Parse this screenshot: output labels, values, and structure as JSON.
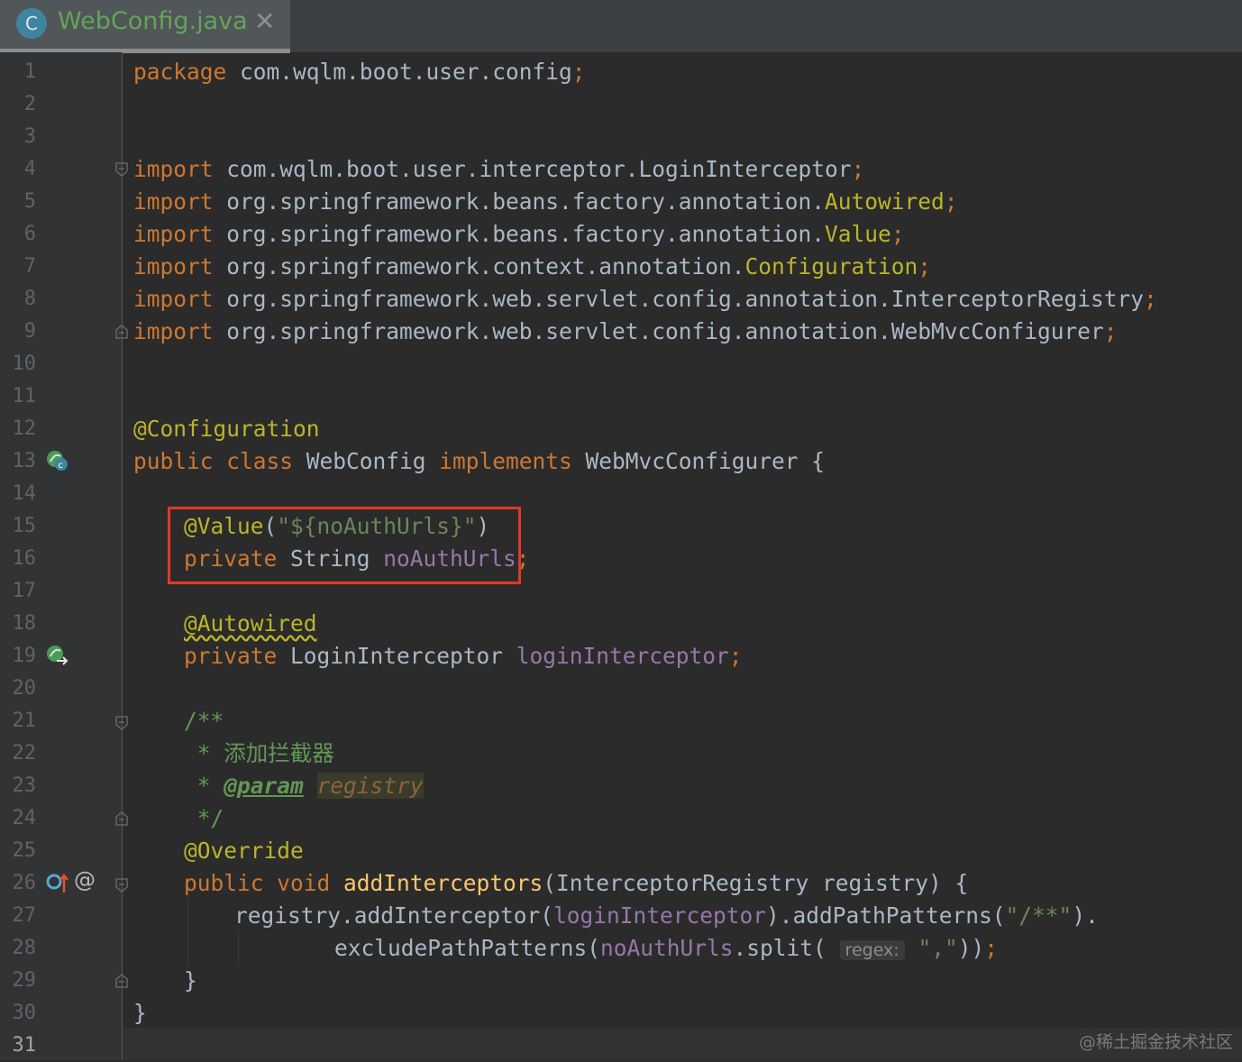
{
  "tab": {
    "icon_letter": "C",
    "title": "WebConfig.java",
    "close": "✕"
  },
  "line_numbers": [
    "1",
    "2",
    "3",
    "4",
    "5",
    "6",
    "7",
    "8",
    "9",
    "10",
    "11",
    "12",
    "13",
    "14",
    "15",
    "16",
    "17",
    "18",
    "19",
    "20",
    "21",
    "22",
    "23",
    "24",
    "25",
    "26",
    "27",
    "28",
    "29",
    "30",
    "31"
  ],
  "code": {
    "l1": {
      "kw": "package",
      "rest": " com.wqlm.boot.user.config",
      "semi": ";"
    },
    "l4": {
      "kw": "import",
      "rest": " com.wqlm.boot.user.interceptor.LoginInterceptor",
      "semi": ";"
    },
    "l5": {
      "kw": "import",
      "rest": " org.springframework.beans.factory.annotation.",
      "ann": "Autowired",
      "semi": ";"
    },
    "l6": {
      "kw": "import",
      "rest": " org.springframework.beans.factory.annotation.",
      "ann": "Value",
      "semi": ";"
    },
    "l7": {
      "kw": "import",
      "rest": " org.springframework.context.annotation.",
      "ann": "Configuration",
      "semi": ";"
    },
    "l8": {
      "kw": "import",
      "rest": " org.springframework.web.servlet.config.annotation.InterceptorRegistry",
      "semi": ";"
    },
    "l9": {
      "kw": "import",
      "rest": " org.springframework.web.servlet.config.annotation.WebMvcConfigurer",
      "semi": ";"
    },
    "l12": {
      "ann": "@Configuration"
    },
    "l13": {
      "kw1": "public class",
      "name": " WebConfig ",
      "kw2": "implements",
      "rest": " WebMvcConfigurer {"
    },
    "l15": {
      "ann": "@Value",
      "open": "(",
      "str": "\"${noAuthUrls}\"",
      "close": ")"
    },
    "l16": {
      "kw": "private",
      "type": " String ",
      "field": "noAuthUrls",
      "semi": ";"
    },
    "l18": {
      "ann": "@Autowired"
    },
    "l19": {
      "kw": "private",
      "type": " LoginInterceptor ",
      "field": "loginInterceptor",
      "semi": ";"
    },
    "l21": {
      "doc": "/**"
    },
    "l22": {
      "doc": " * 添加拦截器"
    },
    "l23": {
      "doc": " * ",
      "tag": "@param",
      "param": "registry"
    },
    "l24": {
      "doc": " */"
    },
    "l25": {
      "ann": "@Override"
    },
    "l26": {
      "kw": "public void",
      "fn": " addInterceptors",
      "rest": "(InterceptorRegistry registry) {"
    },
    "l27": {
      "a": "registry.addInterceptor(",
      "field": "loginInterceptor",
      "b": ").addPathPatterns(",
      "str": "\"/**\"",
      "c": ")."
    },
    "l28": {
      "a": "excludePathPatterns(",
      "field": "noAuthUrls",
      "b": ".split( ",
      "hint": "regex:",
      "str": "\",\"",
      "c": "))",
      "semi": ";"
    },
    "l29": {
      "text": "}"
    },
    "l30": {
      "text": "}"
    }
  },
  "gutter_icons": {
    "l13": "bean-class-icon",
    "l19": "autowired-navigate-icon",
    "l26": "override-method-icon",
    "l26_at": "@"
  },
  "watermark": "@稀土掘金技术社区",
  "colors": {
    "background": "#2b2b2b",
    "keyword": "#cc7832",
    "annotation": "#bbb529",
    "string": "#6a8759",
    "field": "#9876aa",
    "doc_comment": "#629755",
    "highlight_box": "#e0392b"
  }
}
